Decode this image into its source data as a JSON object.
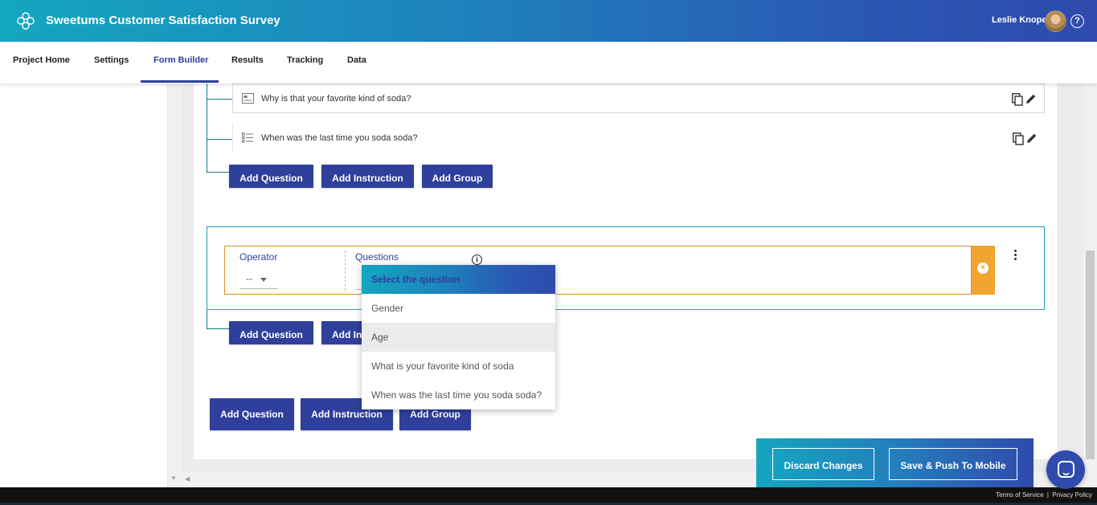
{
  "header": {
    "title": "Sweetums Customer Satisfaction Survey",
    "user_name": "Leslie Knope",
    "help_glyph": "?",
    "logo_icon": "flower-logo-icon",
    "gradient": [
      "#14a6c0",
      "#2f4bad"
    ]
  },
  "nav": {
    "tabs": [
      {
        "label": "Project Home"
      },
      {
        "label": "Settings"
      },
      {
        "label": "Form Builder",
        "active": true
      },
      {
        "label": "Results"
      },
      {
        "label": "Tracking"
      },
      {
        "label": "Data"
      }
    ]
  },
  "questions": [
    {
      "text": "Why is that your favorite kind of soda?",
      "icon": "text-field-icon"
    },
    {
      "text": "When was the last time you soda soda?",
      "icon": "list-icon"
    }
  ],
  "group_buttons": {
    "add_question": "Add Question",
    "add_instruction": "Add Instruction",
    "add_group": "Add Group"
  },
  "condition": {
    "operator_label": "Operator",
    "operator_value": "--",
    "questions_label": "Questions",
    "info_glyph": "i",
    "remove_glyph": "×"
  },
  "condition_buttons": {
    "add_question": "Add Question",
    "add_instruction_partial": "Add In"
  },
  "dropdown": {
    "header": "Select the question",
    "options": [
      "Gender",
      "Age",
      "What is your favorite kind of soda",
      "When was the last time you soda soda?"
    ],
    "hovered": "Age"
  },
  "page_buttons": {
    "add_question": "Add Question",
    "add_instruction": "Add Instruction",
    "add_group": "Add Group"
  },
  "action_bar": {
    "discard": "Discard Changes",
    "save": "Save & Push To Mobile"
  },
  "footer": {
    "terms": "Terms of Service",
    "separator": "|",
    "privacy": "Privacy Policy"
  },
  "colors": {
    "primary": "#2f3f9c",
    "teal": "#24a0b3",
    "orange": "#f0a530"
  }
}
